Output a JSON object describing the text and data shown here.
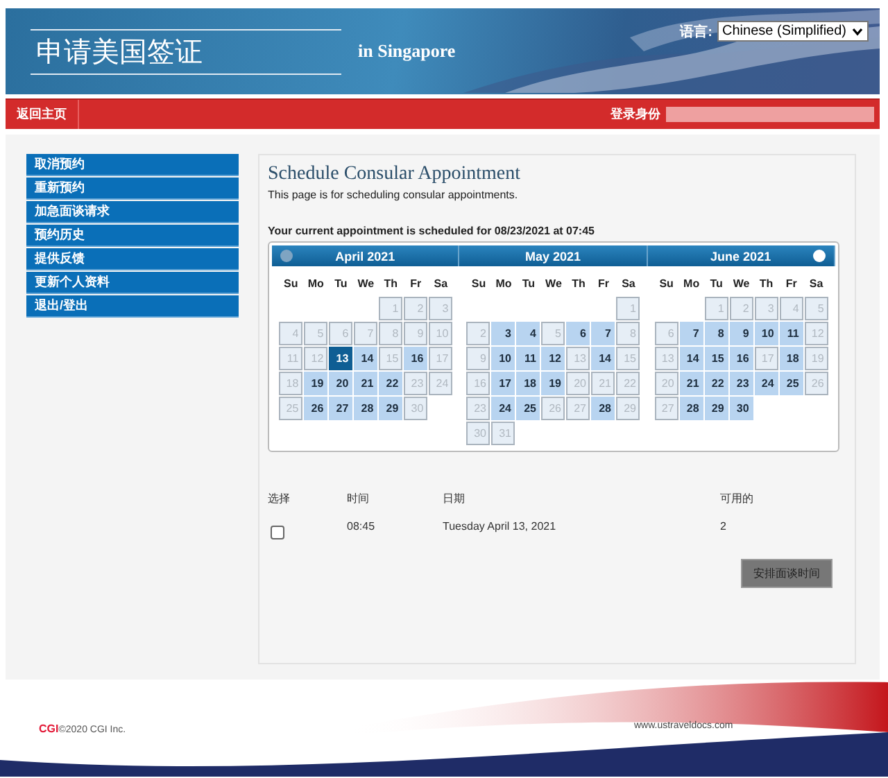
{
  "header": {
    "title": "申请美国签证",
    "location": "in Singapore",
    "language_label": "语言:",
    "language_value": "Chinese (Simplified)"
  },
  "nav": {
    "home": "返回主页",
    "login_label": "登录身份"
  },
  "sidebar": {
    "items": [
      {
        "label": "取消预约"
      },
      {
        "label": "重新预约"
      },
      {
        "label": "加急面谈请求"
      },
      {
        "label": "预约历史"
      },
      {
        "label": "提供反馈"
      },
      {
        "label": "更新个人资料"
      },
      {
        "label": "退出/登出"
      }
    ]
  },
  "main": {
    "title": "Schedule Consular Appointment",
    "subtitle": "This page is for scheduling consular appointments.",
    "current": "Your current appointment is scheduled for 08/23/2021 at 07:45"
  },
  "calendar": {
    "months": [
      {
        "title": "April 2021",
        "weekdays": [
          "Su",
          "Mo",
          "Tu",
          "We",
          "Th",
          "Fr",
          "Sa"
        ],
        "weeks": [
          [
            {
              "label": "1",
              "available": false,
              "selected": false
            },
            {
              "label": "2",
              "available": false,
              "selected": false
            },
            {
              "label": "3",
              "available": false,
              "selected": false
            }
          ],
          [
            {
              "label": "4",
              "available": false,
              "selected": false
            },
            {
              "label": "5",
              "available": false,
              "selected": false
            },
            {
              "label": "6",
              "available": false,
              "selected": false
            },
            {
              "label": "7",
              "available": false,
              "selected": false
            },
            {
              "label": "8",
              "available": false,
              "selected": false
            },
            {
              "label": "9",
              "available": false,
              "selected": false
            },
            {
              "label": "10",
              "available": false,
              "selected": false
            }
          ],
          [
            {
              "label": "11",
              "available": false,
              "selected": false
            },
            {
              "label": "12",
              "available": false,
              "selected": false
            },
            {
              "label": "13",
              "available": true,
              "selected": true
            },
            {
              "label": "14",
              "available": true,
              "selected": false
            },
            {
              "label": "15",
              "available": false,
              "selected": false
            },
            {
              "label": "16",
              "available": true,
              "selected": false
            },
            {
              "label": "17",
              "available": false,
              "selected": false
            }
          ],
          [
            {
              "label": "18",
              "available": false,
              "selected": false
            },
            {
              "label": "19",
              "available": true,
              "selected": false
            },
            {
              "label": "20",
              "available": true,
              "selected": false
            },
            {
              "label": "21",
              "available": true,
              "selected": false
            },
            {
              "label": "22",
              "available": true,
              "selected": false
            },
            {
              "label": "23",
              "available": false,
              "selected": false
            },
            {
              "label": "24",
              "available": false,
              "selected": false
            }
          ],
          [
            {
              "label": "25",
              "available": false,
              "selected": false
            },
            {
              "label": "26",
              "available": true,
              "selected": false
            },
            {
              "label": "27",
              "available": true,
              "selected": false
            },
            {
              "label": "28",
              "available": true,
              "selected": false
            },
            {
              "label": "29",
              "available": true,
              "selected": false
            },
            {
              "label": "30",
              "available": false,
              "selected": false
            }
          ]
        ]
      },
      {
        "title": "May 2021",
        "weekdays": [
          "Su",
          "Mo",
          "Tu",
          "We",
          "Th",
          "Fr",
          "Sa"
        ],
        "weeks": [
          [
            {
              "label": "1",
              "available": false,
              "selected": false
            }
          ],
          [
            {
              "label": "2",
              "available": false,
              "selected": false
            },
            {
              "label": "3",
              "available": true,
              "selected": false
            },
            {
              "label": "4",
              "available": true,
              "selected": false
            },
            {
              "label": "5",
              "available": false,
              "selected": false
            },
            {
              "label": "6",
              "available": true,
              "selected": false
            },
            {
              "label": "7",
              "available": true,
              "selected": false
            },
            {
              "label": "8",
              "available": false,
              "selected": false
            }
          ],
          [
            {
              "label": "9",
              "available": false,
              "selected": false
            },
            {
              "label": "10",
              "available": true,
              "selected": false
            },
            {
              "label": "11",
              "available": true,
              "selected": false
            },
            {
              "label": "12",
              "available": true,
              "selected": false
            },
            {
              "label": "13",
              "available": false,
              "selected": false
            },
            {
              "label": "14",
              "available": true,
              "selected": false
            },
            {
              "label": "15",
              "available": false,
              "selected": false
            }
          ],
          [
            {
              "label": "16",
              "available": false,
              "selected": false
            },
            {
              "label": "17",
              "available": true,
              "selected": false
            },
            {
              "label": "18",
              "available": true,
              "selected": false
            },
            {
              "label": "19",
              "available": true,
              "selected": false
            },
            {
              "label": "20",
              "available": false,
              "selected": false
            },
            {
              "label": "21",
              "available": false,
              "selected": false
            },
            {
              "label": "22",
              "available": false,
              "selected": false
            }
          ],
          [
            {
              "label": "23",
              "available": false,
              "selected": false
            },
            {
              "label": "24",
              "available": true,
              "selected": false
            },
            {
              "label": "25",
              "available": true,
              "selected": false
            },
            {
              "label": "26",
              "available": false,
              "selected": false
            },
            {
              "label": "27",
              "available": false,
              "selected": false
            },
            {
              "label": "28",
              "available": true,
              "selected": false
            },
            {
              "label": "29",
              "available": false,
              "selected": false
            }
          ],
          [
            {
              "label": "30",
              "available": false,
              "selected": false
            },
            {
              "label": "31",
              "available": false,
              "selected": false
            }
          ]
        ]
      },
      {
        "title": "June 2021",
        "weekdays": [
          "Su",
          "Mo",
          "Tu",
          "We",
          "Th",
          "Fr",
          "Sa"
        ],
        "weeks": [
          [
            {
              "label": "1",
              "available": false,
              "selected": false
            },
            {
              "label": "2",
              "available": false,
              "selected": false
            },
            {
              "label": "3",
              "available": false,
              "selected": false
            },
            {
              "label": "4",
              "available": false,
              "selected": false
            },
            {
              "label": "5",
              "available": false,
              "selected": false
            }
          ],
          [
            {
              "label": "6",
              "available": false,
              "selected": false
            },
            {
              "label": "7",
              "available": true,
              "selected": false
            },
            {
              "label": "8",
              "available": true,
              "selected": false
            },
            {
              "label": "9",
              "available": true,
              "selected": false
            },
            {
              "label": "10",
              "available": true,
              "selected": false
            },
            {
              "label": "11",
              "available": true,
              "selected": false
            },
            {
              "label": "12",
              "available": false,
              "selected": false
            }
          ],
          [
            {
              "label": "13",
              "available": false,
              "selected": false
            },
            {
              "label": "14",
              "available": true,
              "selected": false
            },
            {
              "label": "15",
              "available": true,
              "selected": false
            },
            {
              "label": "16",
              "available": true,
              "selected": false
            },
            {
              "label": "17",
              "available": false,
              "selected": false
            },
            {
              "label": "18",
              "available": true,
              "selected": false
            },
            {
              "label": "19",
              "available": false,
              "selected": false
            }
          ],
          [
            {
              "label": "20",
              "available": false,
              "selected": false
            },
            {
              "label": "21",
              "available": true,
              "selected": false
            },
            {
              "label": "22",
              "available": true,
              "selected": false
            },
            {
              "label": "23",
              "available": true,
              "selected": false
            },
            {
              "label": "24",
              "available": true,
              "selected": false
            },
            {
              "label": "25",
              "available": true,
              "selected": false
            },
            {
              "label": "26",
              "available": false,
              "selected": false
            }
          ],
          [
            {
              "label": "27",
              "available": false,
              "selected": false
            },
            {
              "label": "28",
              "available": true,
              "selected": false
            },
            {
              "label": "29",
              "available": true,
              "selected": false
            },
            {
              "label": "30",
              "available": true,
              "selected": false
            }
          ]
        ]
      }
    ]
  },
  "slots": {
    "columns": [
      "选择",
      "时间",
      "日期",
      "可用的"
    ],
    "rows": [
      {
        "checked": false,
        "time": "08:45",
        "date": "Tuesday April 13, 2021",
        "available": "2"
      }
    ],
    "button": "安排面谈时间"
  },
  "footer": {
    "logo": "CGI",
    "copyright": "©2020 CGI Inc.",
    "url": "www.ustraveldocs.com"
  }
}
